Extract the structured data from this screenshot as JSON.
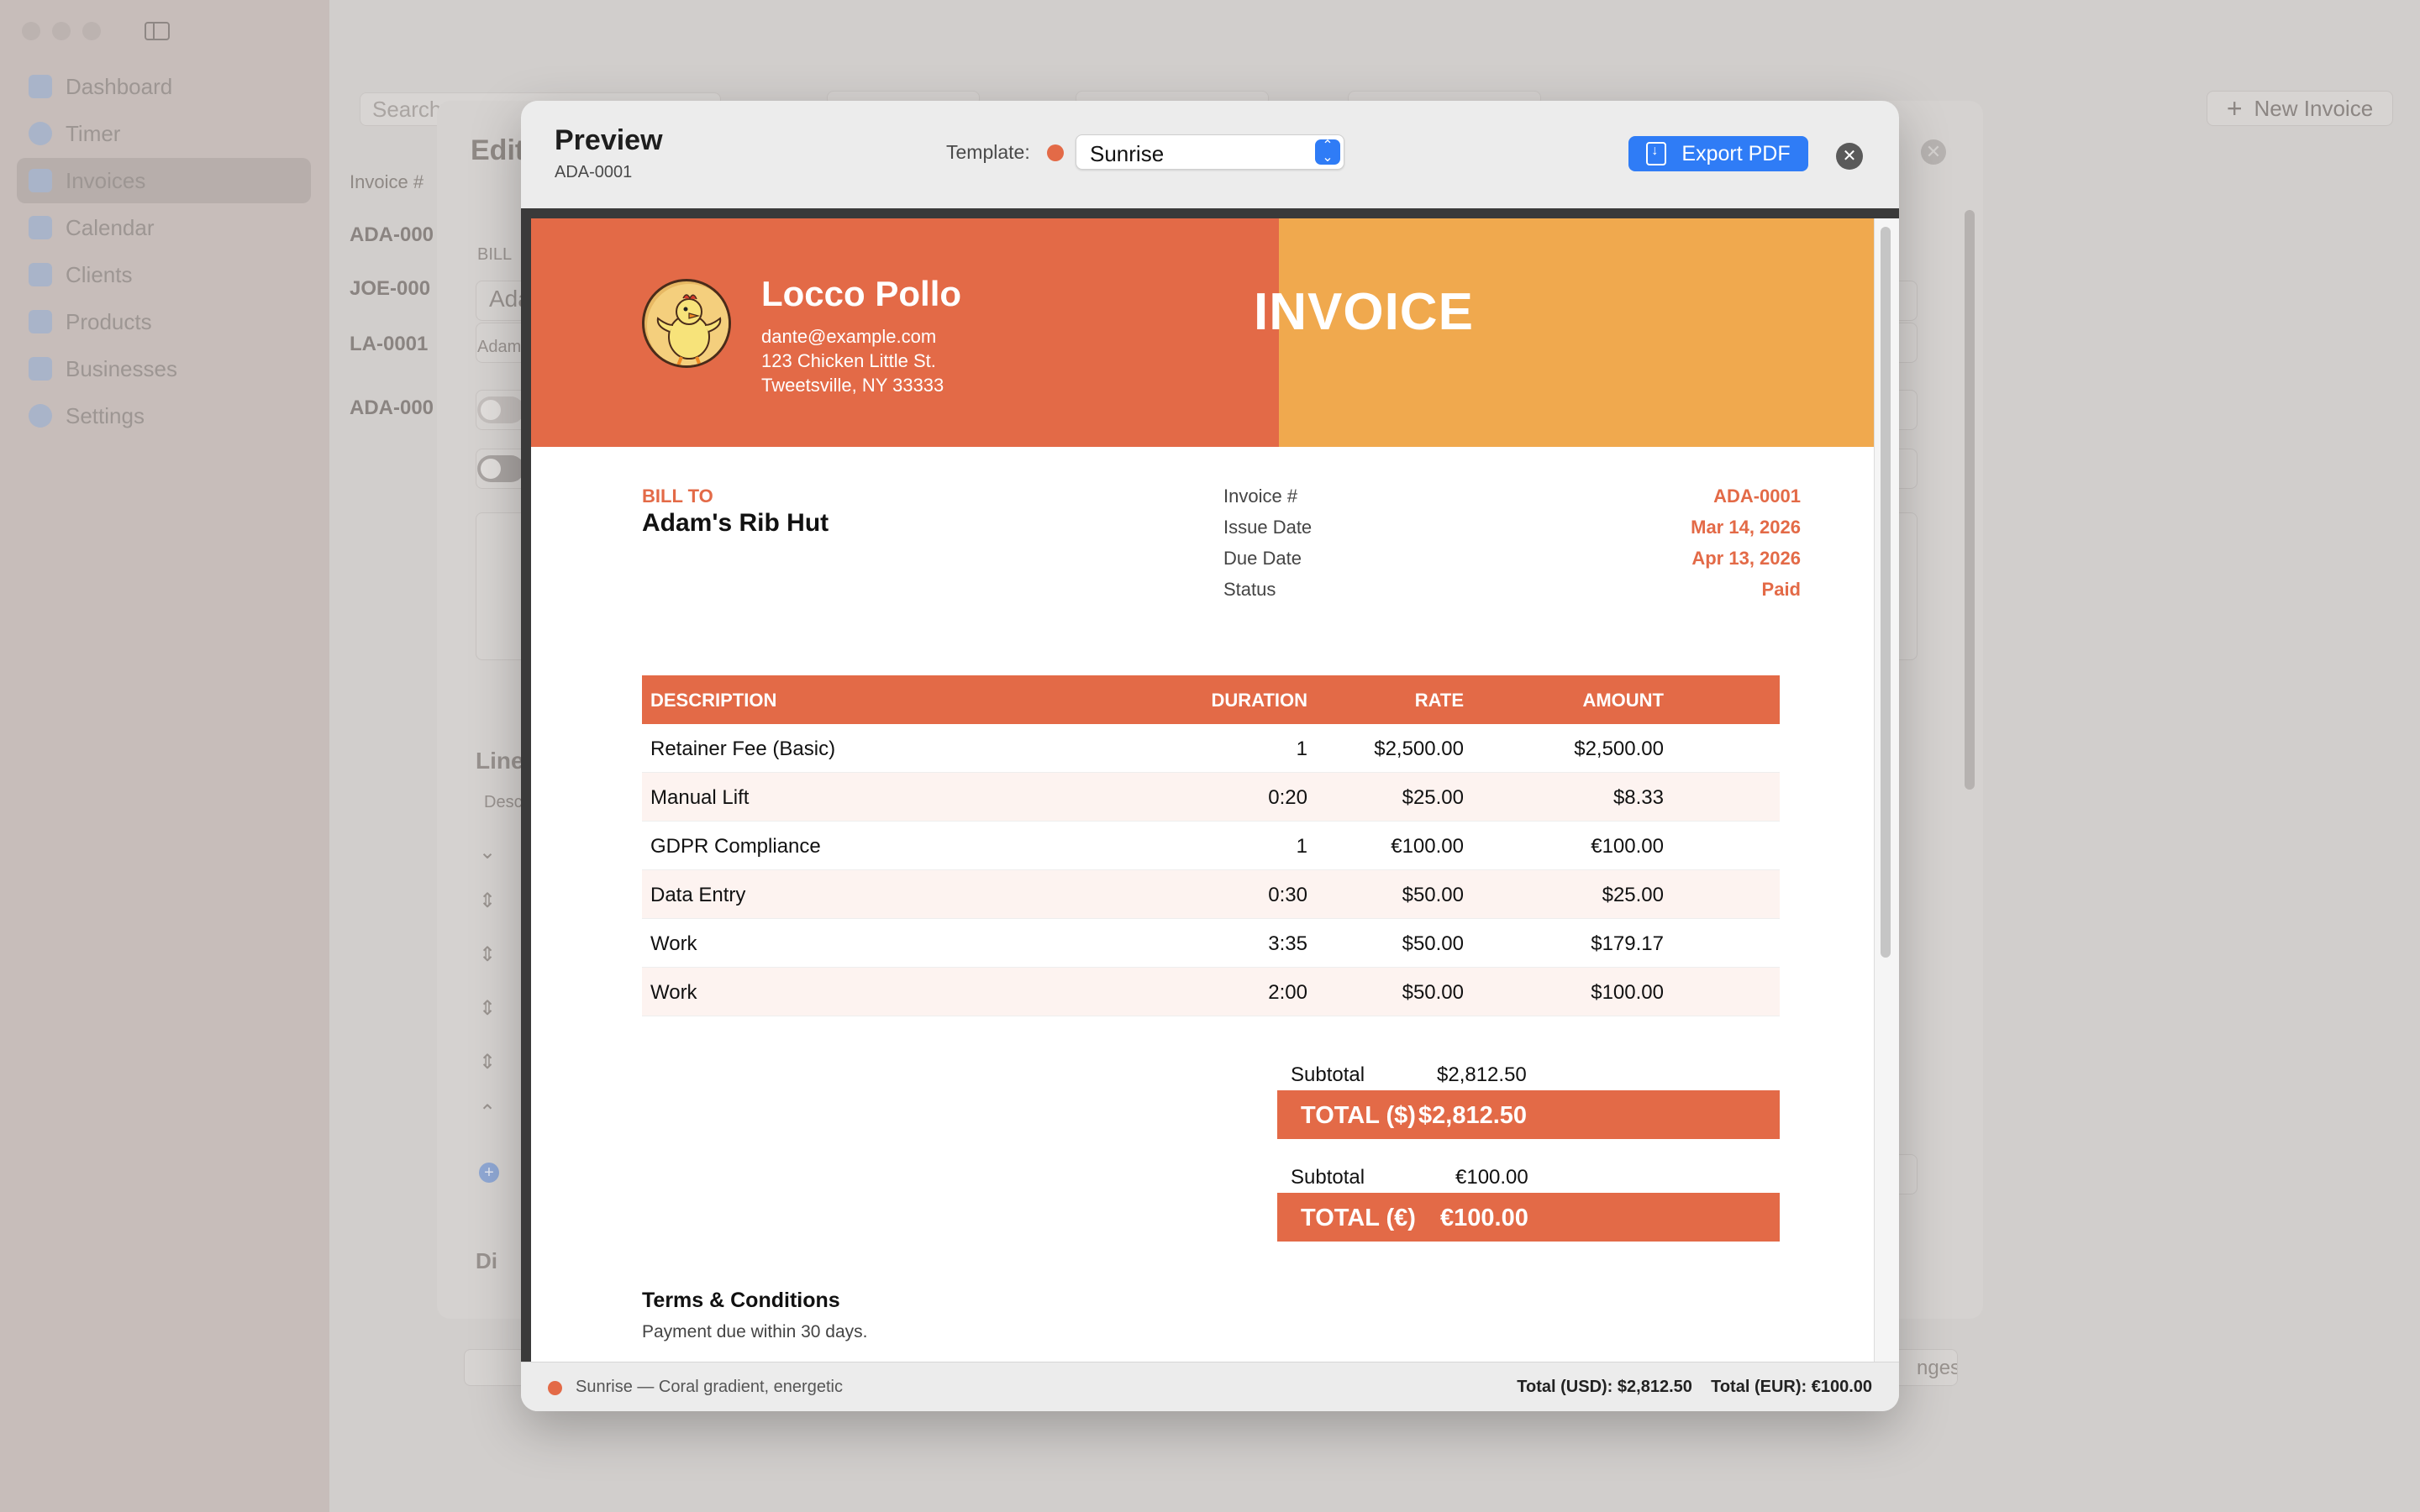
{
  "sidebar": {
    "items": [
      {
        "label": "Dashboard"
      },
      {
        "label": "Timer"
      },
      {
        "label": "Invoices"
      },
      {
        "label": "Calendar"
      },
      {
        "label": "Clients"
      },
      {
        "label": "Products"
      },
      {
        "label": "Businesses"
      },
      {
        "label": "Settings"
      }
    ]
  },
  "toolbar": {
    "search_placeholder": "Search",
    "new_invoice_label": "New Invoice"
  },
  "invoice_list": {
    "header": "Invoice #",
    "rows": [
      "ADA-000",
      "JOE-000",
      "LA-0001",
      "ADA-000"
    ]
  },
  "editor": {
    "title": "Edit",
    "bill_to_label": "BILL",
    "client_value": "Ada",
    "client_hint": "Adam",
    "line_items_label": "Line",
    "desc_label": "Desc",
    "discount_label": "Di",
    "save_label": "nges"
  },
  "preview": {
    "title": "Preview",
    "invoice_id": "ADA-0001",
    "template_label": "Template:",
    "template_value": "Sunrise",
    "template_color": "#E36A47",
    "export_label": "Export PDF"
  },
  "invoice": {
    "company": {
      "name": "Locco Pollo",
      "email": "dante@example.com",
      "address1": "123 Chicken Little St.",
      "address2": "Tweetsville, NY 33333"
    },
    "title": "INVOICE",
    "bill_to_label": "BILL TO",
    "bill_to_name": "Adam's Rib Hut",
    "meta": [
      {
        "label": "Invoice #",
        "value": "ADA-0001"
      },
      {
        "label": "Issue Date",
        "value": "Mar 14, 2026"
      },
      {
        "label": "Due Date",
        "value": "Apr 13, 2026"
      },
      {
        "label": "Status",
        "value": "Paid"
      }
    ],
    "columns": {
      "description": "DESCRIPTION",
      "duration": "DURATION",
      "rate": "RATE",
      "amount": "AMOUNT"
    },
    "items": [
      {
        "description": "Retainer Fee (Basic)",
        "duration": "1",
        "rate": "$2,500.00",
        "amount": "$2,500.00"
      },
      {
        "description": "Manual Lift",
        "duration": "0:20",
        "rate": "$25.00",
        "amount": "$8.33"
      },
      {
        "description": "GDPR Compliance",
        "duration": "1",
        "rate": "€100.00",
        "amount": "€100.00"
      },
      {
        "description": "Data Entry",
        "duration": "0:30",
        "rate": "$50.00",
        "amount": "$25.00"
      },
      {
        "description": "Work",
        "duration": "3:35",
        "rate": "$50.00",
        "amount": "$179.17"
      },
      {
        "description": "Work",
        "duration": "2:00",
        "rate": "$50.00",
        "amount": "$100.00"
      }
    ],
    "usd": {
      "subtotal_label": "Subtotal",
      "subtotal": "$2,812.50",
      "total_label": "TOTAL ($)",
      "total": "$2,812.50"
    },
    "eur": {
      "subtotal_label": "Subtotal",
      "subtotal": "€100.00",
      "total_label": "TOTAL (€)",
      "total": "€100.00"
    },
    "terms_title": "Terms & Conditions",
    "terms_text": "Payment due within 30 days."
  },
  "status_bar": {
    "template_desc": "Sunrise — Coral gradient, energetic",
    "totals": "Total (USD): $2,812.50    Total (EUR): €100.00"
  },
  "colors": {
    "accent": "#E36A47",
    "header_right": "#F0A94E",
    "button_blue": "#2F7CF6"
  }
}
